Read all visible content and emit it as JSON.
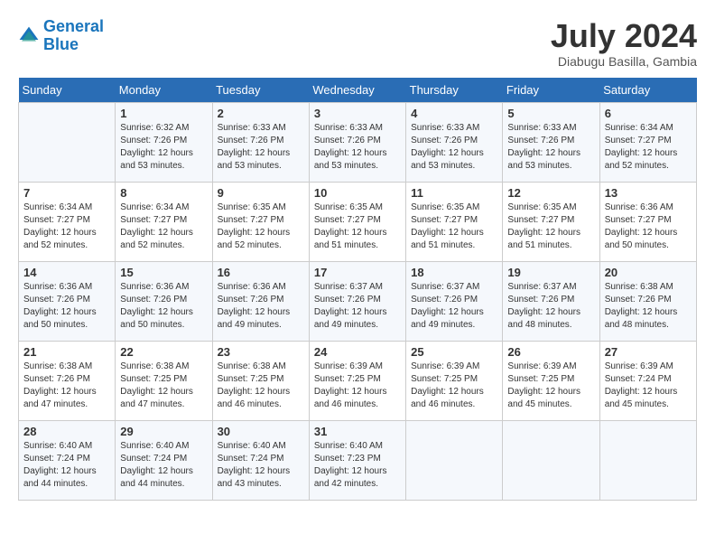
{
  "header": {
    "logo_line1": "General",
    "logo_line2": "Blue",
    "month_year": "July 2024",
    "location": "Diabugu Basilla, Gambia"
  },
  "days_of_week": [
    "Sunday",
    "Monday",
    "Tuesday",
    "Wednesday",
    "Thursday",
    "Friday",
    "Saturday"
  ],
  "weeks": [
    [
      {
        "day": "",
        "info": ""
      },
      {
        "day": "1",
        "info": "Sunrise: 6:32 AM\nSunset: 7:26 PM\nDaylight: 12 hours and 53 minutes."
      },
      {
        "day": "2",
        "info": "Sunrise: 6:33 AM\nSunset: 7:26 PM\nDaylight: 12 hours and 53 minutes."
      },
      {
        "day": "3",
        "info": "Sunrise: 6:33 AM\nSunset: 7:26 PM\nDaylight: 12 hours and 53 minutes."
      },
      {
        "day": "4",
        "info": "Sunrise: 6:33 AM\nSunset: 7:26 PM\nDaylight: 12 hours and 53 minutes."
      },
      {
        "day": "5",
        "info": "Sunrise: 6:33 AM\nSunset: 7:26 PM\nDaylight: 12 hours and 53 minutes."
      },
      {
        "day": "6",
        "info": "Sunrise: 6:34 AM\nSunset: 7:27 PM\nDaylight: 12 hours and 52 minutes."
      }
    ],
    [
      {
        "day": "7",
        "info": "Sunrise: 6:34 AM\nSunset: 7:27 PM\nDaylight: 12 hours and 52 minutes."
      },
      {
        "day": "8",
        "info": "Sunrise: 6:34 AM\nSunset: 7:27 PM\nDaylight: 12 hours and 52 minutes."
      },
      {
        "day": "9",
        "info": "Sunrise: 6:35 AM\nSunset: 7:27 PM\nDaylight: 12 hours and 52 minutes."
      },
      {
        "day": "10",
        "info": "Sunrise: 6:35 AM\nSunset: 7:27 PM\nDaylight: 12 hours and 51 minutes."
      },
      {
        "day": "11",
        "info": "Sunrise: 6:35 AM\nSunset: 7:27 PM\nDaylight: 12 hours and 51 minutes."
      },
      {
        "day": "12",
        "info": "Sunrise: 6:35 AM\nSunset: 7:27 PM\nDaylight: 12 hours and 51 minutes."
      },
      {
        "day": "13",
        "info": "Sunrise: 6:36 AM\nSunset: 7:27 PM\nDaylight: 12 hours and 50 minutes."
      }
    ],
    [
      {
        "day": "14",
        "info": "Sunrise: 6:36 AM\nSunset: 7:26 PM\nDaylight: 12 hours and 50 minutes."
      },
      {
        "day": "15",
        "info": "Sunrise: 6:36 AM\nSunset: 7:26 PM\nDaylight: 12 hours and 50 minutes."
      },
      {
        "day": "16",
        "info": "Sunrise: 6:36 AM\nSunset: 7:26 PM\nDaylight: 12 hours and 49 minutes."
      },
      {
        "day": "17",
        "info": "Sunrise: 6:37 AM\nSunset: 7:26 PM\nDaylight: 12 hours and 49 minutes."
      },
      {
        "day": "18",
        "info": "Sunrise: 6:37 AM\nSunset: 7:26 PM\nDaylight: 12 hours and 49 minutes."
      },
      {
        "day": "19",
        "info": "Sunrise: 6:37 AM\nSunset: 7:26 PM\nDaylight: 12 hours and 48 minutes."
      },
      {
        "day": "20",
        "info": "Sunrise: 6:38 AM\nSunset: 7:26 PM\nDaylight: 12 hours and 48 minutes."
      }
    ],
    [
      {
        "day": "21",
        "info": "Sunrise: 6:38 AM\nSunset: 7:26 PM\nDaylight: 12 hours and 47 minutes."
      },
      {
        "day": "22",
        "info": "Sunrise: 6:38 AM\nSunset: 7:25 PM\nDaylight: 12 hours and 47 minutes."
      },
      {
        "day": "23",
        "info": "Sunrise: 6:38 AM\nSunset: 7:25 PM\nDaylight: 12 hours and 46 minutes."
      },
      {
        "day": "24",
        "info": "Sunrise: 6:39 AM\nSunset: 7:25 PM\nDaylight: 12 hours and 46 minutes."
      },
      {
        "day": "25",
        "info": "Sunrise: 6:39 AM\nSunset: 7:25 PM\nDaylight: 12 hours and 46 minutes."
      },
      {
        "day": "26",
        "info": "Sunrise: 6:39 AM\nSunset: 7:25 PM\nDaylight: 12 hours and 45 minutes."
      },
      {
        "day": "27",
        "info": "Sunrise: 6:39 AM\nSunset: 7:24 PM\nDaylight: 12 hours and 45 minutes."
      }
    ],
    [
      {
        "day": "28",
        "info": "Sunrise: 6:40 AM\nSunset: 7:24 PM\nDaylight: 12 hours and 44 minutes."
      },
      {
        "day": "29",
        "info": "Sunrise: 6:40 AM\nSunset: 7:24 PM\nDaylight: 12 hours and 44 minutes."
      },
      {
        "day": "30",
        "info": "Sunrise: 6:40 AM\nSunset: 7:24 PM\nDaylight: 12 hours and 43 minutes."
      },
      {
        "day": "31",
        "info": "Sunrise: 6:40 AM\nSunset: 7:23 PM\nDaylight: 12 hours and 42 minutes."
      },
      {
        "day": "",
        "info": ""
      },
      {
        "day": "",
        "info": ""
      },
      {
        "day": "",
        "info": ""
      }
    ]
  ]
}
